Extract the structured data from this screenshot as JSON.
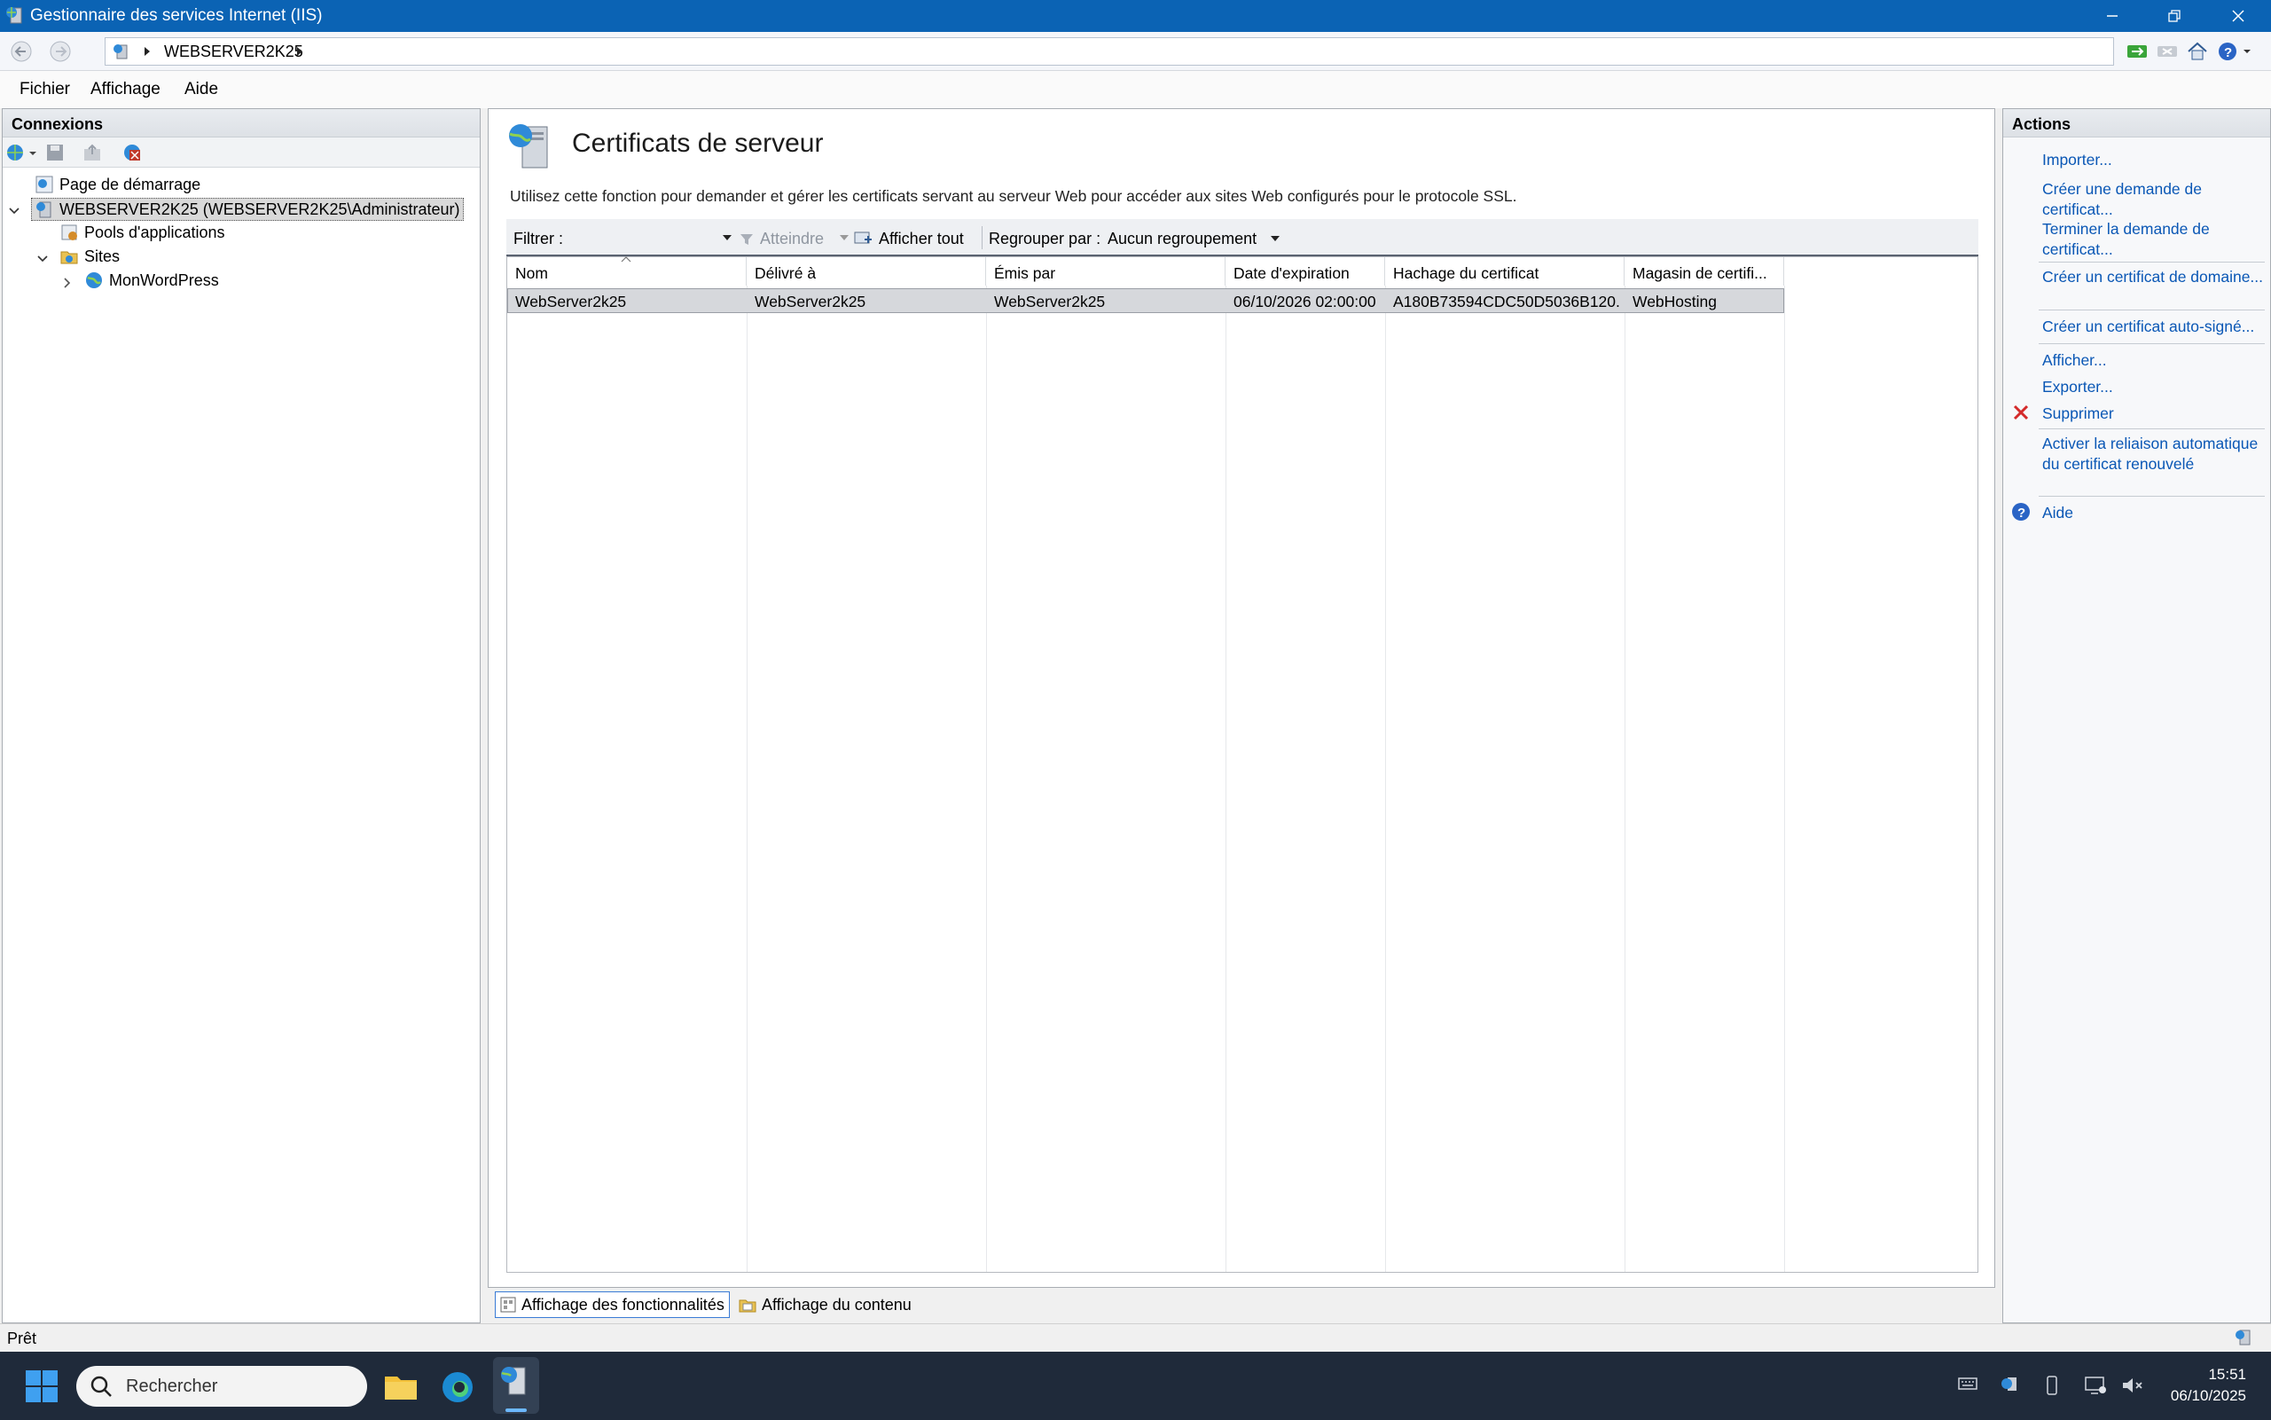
{
  "window": {
    "title": "Gestionnaire des services Internet (IIS)"
  },
  "address": {
    "segment": "WEBSERVER2K25"
  },
  "menu": {
    "file": "Fichier",
    "view": "Affichage",
    "help": "Aide"
  },
  "connections": {
    "title": "Connexions",
    "tree": {
      "start_page": "Page de démarrage",
      "server": "WEBSERVER2K25 (WEBSERVER2K25\\Administrateur)",
      "app_pools": "Pools d'applications",
      "sites": "Sites",
      "site1": "MonWordPress"
    }
  },
  "main": {
    "title": "Certificats de serveur",
    "description": "Utilisez cette fonction pour demander et gérer les certificats servant au serveur Web pour accéder aux sites Web configurés pour le protocole SSL.",
    "filter": {
      "label": "Filtrer :",
      "go": "Atteindre",
      "show_all": "Afficher tout",
      "group_label": "Regrouper par :",
      "group_value": "Aucun regroupement"
    },
    "columns": [
      "Nom",
      "Délivré à",
      "Émis par",
      "Date d'expiration",
      "Hachage du certificat",
      "Magasin de certifi..."
    ],
    "rows": [
      {
        "name": "WebServer2k25",
        "issued_to": "WebServer2k25",
        "issued_by": "WebServer2k25",
        "expiration": "06/10/2026 02:00:00",
        "hash": "A180B73594CDC50D5036B120...",
        "store": "WebHosting"
      }
    ]
  },
  "bottom_tabs": {
    "features": "Affichage des fonctionnalités",
    "content": "Affichage du contenu"
  },
  "actions": {
    "title": "Actions",
    "import": "Importer...",
    "create_request": "Créer une demande de certificat...",
    "complete_request": "Terminer la demande de certificat...",
    "create_domain": "Créer un certificat de domaine...",
    "create_selfsigned": "Créer un certificat auto-signé...",
    "view": "Afficher...",
    "export": "Exporter...",
    "delete": "Supprimer",
    "auto_rebind": "Activer la reliaison automatique du certificat renouvelé",
    "help": "Aide"
  },
  "status": {
    "text": "Prêt"
  },
  "taskbar": {
    "search_placeholder": "Rechercher",
    "time": "15:51",
    "date": "06/10/2025"
  },
  "colors": {
    "titlebar": "#0b63b4",
    "link": "#0a57b5",
    "taskbar": "#1f2a3a",
    "selected_row": "#d6d8dc"
  }
}
